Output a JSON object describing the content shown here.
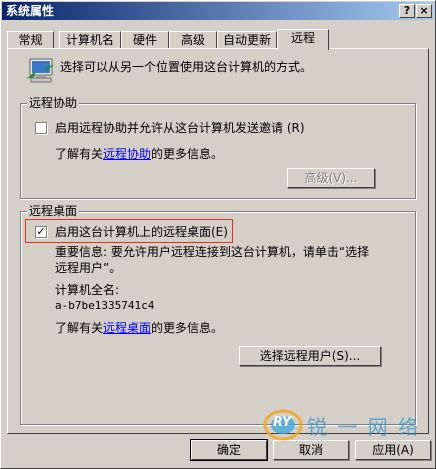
{
  "window": {
    "title": "系统属性",
    "help_btn": "?",
    "close_btn": "×"
  },
  "tabs": [
    {
      "label": "常规"
    },
    {
      "label": "计算机名"
    },
    {
      "label": "硬件"
    },
    {
      "label": "高级"
    },
    {
      "label": "自动更新"
    },
    {
      "label": "远程"
    }
  ],
  "intro_text": "选择可以从另一个位置使用这台计算机的方式。",
  "remote_assistance": {
    "title": "远程协助",
    "checkbox_label": "启用远程协助并允许从这台计算机发送邀请 (R)",
    "checked": false,
    "learn_prefix": "了解有关",
    "learn_link": "远程协助",
    "learn_suffix": "的更多信息。",
    "advanced_button": "高级(V)..."
  },
  "remote_desktop": {
    "title": "远程桌面",
    "checkbox_label": "启用这台计算机上的远程桌面(E)",
    "checked": true,
    "note_line1": "重要信息: 要允许用户远程连接到这台计算机，请单击“选择",
    "note_line2": "远程用户”。",
    "computer_name_label": "计算机全名:",
    "computer_name_value": "a-b7be1335741c4",
    "learn_prefix": "了解有关",
    "learn_link": "远程桌面",
    "learn_suffix": "的更多信息。",
    "select_users_button": "选择远程用户(S)..."
  },
  "footer": {
    "ok_button": "确定",
    "cancel_button": "取消",
    "apply_button": "应用(A)"
  },
  "watermark": {
    "brand": "RY",
    "text": "锐 一 网 络"
  }
}
